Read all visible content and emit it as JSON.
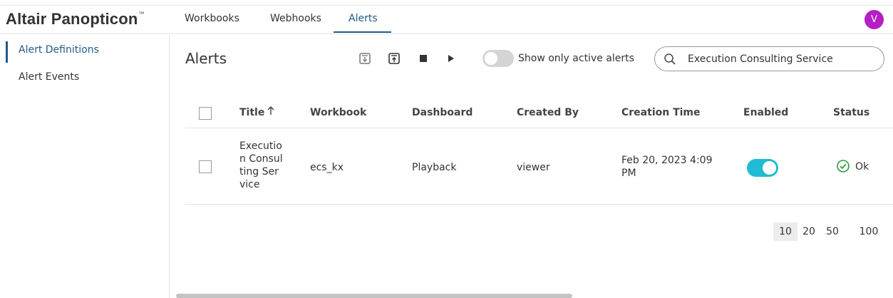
{
  "brand": {
    "name": "Altair Panopticon",
    "trademark": "™"
  },
  "nav": {
    "tabs": [
      {
        "label": "Workbooks"
      },
      {
        "label": "Webhooks"
      },
      {
        "label": "Alerts"
      }
    ],
    "active": "Alerts"
  },
  "user": {
    "initial": "V",
    "avatar_color": "#b51ec4"
  },
  "sidebar": {
    "items": [
      {
        "label": "Alert Definitions"
      },
      {
        "label": "Alert Events"
      }
    ],
    "active": "Alert Definitions"
  },
  "page": {
    "title": "Alerts"
  },
  "toolbar": {
    "icons": [
      "import-icon",
      "export-icon",
      "stop-icon",
      "play-icon"
    ]
  },
  "filter": {
    "label": "Show only active alerts",
    "on": false
  },
  "search": {
    "value": "Execution Consulting Service",
    "placeholder": ""
  },
  "table": {
    "columns": [
      "Title",
      "Workbook",
      "Dashboard",
      "Created By",
      "Creation Time",
      "Enabled",
      "Status"
    ],
    "sort": {
      "column": "Title",
      "direction": "ascending",
      "icon": "arrow-up-icon"
    },
    "rows": [
      {
        "title": "Execution Consulting Service",
        "workbook": "ecs_kx",
        "dashboard": "Playback",
        "created_by": "viewer",
        "creation_time": "Feb 20, 2023 4:09 PM",
        "enabled": true,
        "status": "Ok"
      }
    ]
  },
  "pagination": {
    "sizes": [
      "10",
      "20",
      "50",
      "100"
    ],
    "selected": "10"
  },
  "colors": {
    "accent": "#1f5a8a",
    "toggle_on": "#1fbcd3",
    "status_ok": "#2e9a3e"
  }
}
